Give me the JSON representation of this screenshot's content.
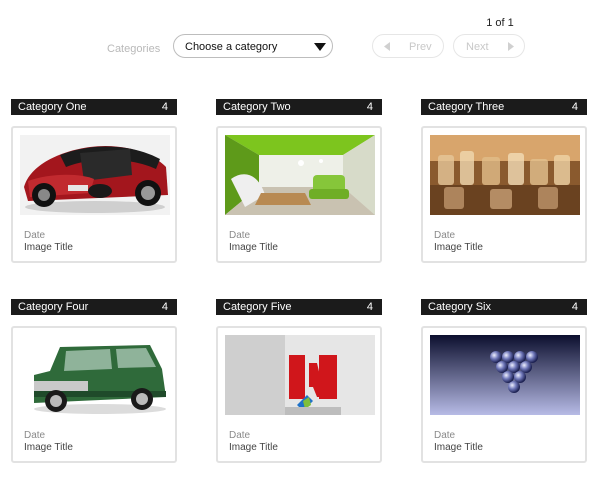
{
  "pagination": {
    "count_label": "1 of 1",
    "prev_label": "Prev",
    "next_label": "Next"
  },
  "filter": {
    "label": "Categories",
    "selected": "Choose a category"
  },
  "categories": [
    {
      "name": "Category One",
      "count": "4",
      "date": "Date",
      "title": "Image Title",
      "image": "red-sports-car"
    },
    {
      "name": "Category Two",
      "count": "4",
      "date": "Date",
      "title": "Image Title",
      "image": "green-interior-room"
    },
    {
      "name": "Category Three",
      "count": "4",
      "date": "Date",
      "title": "Image Title",
      "image": "glassware-on-bar"
    },
    {
      "name": "Category Four",
      "count": "4",
      "date": "Date",
      "title": "Image Title",
      "image": "green-suv"
    },
    {
      "name": "Category Five",
      "count": "4",
      "date": "Date",
      "title": "Image Title",
      "image": "adobe-logo"
    },
    {
      "name": "Category Six",
      "count": "4",
      "date": "Date",
      "title": "Image Title",
      "image": "billiard-balls"
    }
  ],
  "colors": {
    "header_bar": "#1b1b1b",
    "border": "#e2e2e2"
  }
}
